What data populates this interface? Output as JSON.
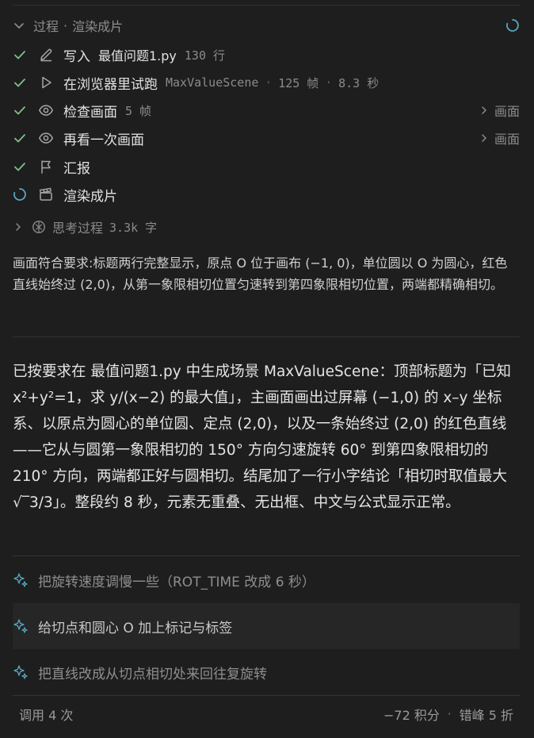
{
  "header": {
    "title": "过程",
    "subtitle": "渲染成片"
  },
  "steps": [
    {
      "name": "写入",
      "file": "最值问题1.py",
      "lines": "130 行",
      "status": "done",
      "icon": "pencil-icon"
    },
    {
      "name": "在浏览器里试跑",
      "scene": "MaxValueScene",
      "frames": "125 帧",
      "duration": "8.3 秒",
      "status": "done",
      "icon": "play-icon"
    },
    {
      "name": "检查画面",
      "frames": "5 帧",
      "link": "画面",
      "status": "done",
      "icon": "eye-icon"
    },
    {
      "name": "再看一次画面",
      "link": "画面",
      "status": "done",
      "icon": "eye-icon"
    },
    {
      "name": "汇报",
      "status": "done",
      "icon": "flag-icon"
    },
    {
      "name": "渲染成片",
      "status": "running",
      "icon": "clapperboard-icon"
    }
  ],
  "thinking": {
    "label": "思考过程",
    "size": "3.3k 字"
  },
  "note": "画面符合要求:标题两行完整显示，原点 O 位于画布 (−1, 0)，单位圆以 O 为圆心，红色直线始终过 (2,0)，从第一象限相切位置匀速转到第四象限相切位置，两端都精确相切。",
  "summary": "已按要求在 最值问题1.py 中生成场景 MaxValueScene：顶部标题为「已知 x²+y²=1，求 y/(x−2) 的最大值」，主画面画出过屏幕 (−1,0) 的 x–y 坐标系、以原点为圆心的单位圆、定点 (2,0)，以及一条始终过 (2,0) 的红色直线——它从与圆第一象限相切的 150° 方向匀速旋转 60° 到第四象限相切的 210° 方向，两端都正好与圆相切。结尾加了一行小字结论「相切时取值最大 √‾3/3」。整段约 8 秒，元素无重叠、无出框、中文与公式显示正常。",
  "suggestions": [
    "把旋转速度调慢一些（ROT_TIME 改成 6 秒）",
    "给切点和圆心 O 加上标记与标签",
    "把直线改成从切点相切处来回往复旋转"
  ],
  "footer": {
    "calls": "调用 4 次",
    "points": "−72 积分",
    "peak": "错峰 5 折"
  },
  "colors": {
    "check": "#7fc08a",
    "accent": "#57a7c2",
    "background": "#1e1e1e"
  }
}
